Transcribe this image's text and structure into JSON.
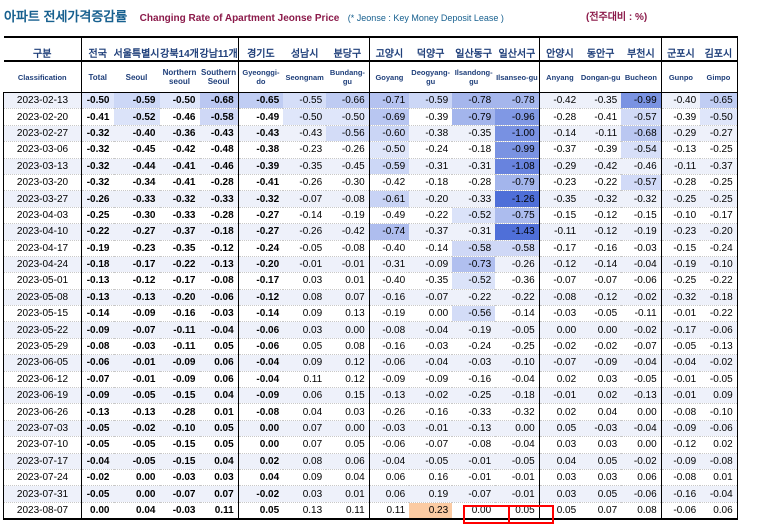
{
  "header": {
    "title_ko": "아파트 전세가격증감률",
    "title_en": "Changing Rate of Apartment Jeonse Price",
    "title_note": "(* Jeonse : Key Money Deposit Lease )",
    "unit": "(전주대비 : %)"
  },
  "table": {
    "columns_ko": [
      "구분",
      "전국",
      "서울특별시",
      "강북14개",
      "강남11개",
      "경기도",
      "성남시",
      "분당구",
      "고양시",
      "덕양구",
      "일산동구",
      "일산서구",
      "안양시",
      "동안구",
      "부천시",
      "군포시",
      "김포시"
    ],
    "columns_en": [
      "Classification",
      "Total",
      "Seoul",
      "Northern seoul",
      "Southern Seoul",
      "Gyeonggi-do",
      "Seongnam",
      "Bundang-gu",
      "Goyang",
      "Deogyang-gu",
      "Ilsandong-gu",
      "Ilsanseo-gu",
      "Anyang",
      "Dongan-gu",
      "Bucheon",
      "Gunpo",
      "Gimpo"
    ],
    "rows": [
      {
        "date": "2023-02-13",
        "values": [
          "-0.50",
          "-0.59",
          "-0.50",
          "-0.68",
          "-0.65",
          "-0.55",
          "-0.66",
          "-0.71",
          "-0.59",
          "-0.78",
          "-0.78",
          "-0.42",
          "-0.35",
          "-0.99",
          "-0.40",
          "-0.65"
        ]
      },
      {
        "date": "2023-02-20",
        "values": [
          "-0.41",
          "-0.52",
          "-0.46",
          "-0.58",
          "-0.49",
          "-0.50",
          "-0.50",
          "-0.69",
          "-0.39",
          "-0.79",
          "-0.96",
          "-0.28",
          "-0.41",
          "-0.57",
          "-0.39",
          "-0.50"
        ]
      },
      {
        "date": "2023-02-27",
        "values": [
          "-0.32",
          "-0.40",
          "-0.36",
          "-0.43",
          "-0.43",
          "-0.43",
          "-0.56",
          "-0.60",
          "-0.38",
          "-0.35",
          "-1.00",
          "-0.14",
          "-0.11",
          "-0.68",
          "-0.29",
          "-0.27"
        ]
      },
      {
        "date": "2023-03-06",
        "values": [
          "-0.32",
          "-0.45",
          "-0.42",
          "-0.48",
          "-0.38",
          "-0.23",
          "-0.26",
          "-0.50",
          "-0.24",
          "-0.18",
          "-0.99",
          "-0.37",
          "-0.39",
          "-0.54",
          "-0.13",
          "-0.25"
        ]
      },
      {
        "date": "2023-03-13",
        "values": [
          "-0.32",
          "-0.44",
          "-0.41",
          "-0.46",
          "-0.39",
          "-0.35",
          "-0.45",
          "-0.59",
          "-0.31",
          "-0.31",
          "-1.08",
          "-0.29",
          "-0.42",
          "-0.46",
          "-0.11",
          "-0.37"
        ]
      },
      {
        "date": "2023-03-20",
        "values": [
          "-0.32",
          "-0.34",
          "-0.41",
          "-0.28",
          "-0.41",
          "-0.26",
          "-0.30",
          "-0.42",
          "-0.18",
          "-0.28",
          "-0.79",
          "-0.23",
          "-0.22",
          "-0.57",
          "-0.28",
          "-0.25"
        ]
      },
      {
        "date": "2023-03-27",
        "values": [
          "-0.26",
          "-0.33",
          "-0.32",
          "-0.33",
          "-0.32",
          "-0.07",
          "-0.08",
          "-0.61",
          "-0.20",
          "-0.33",
          "-1.26",
          "-0.35",
          "-0.32",
          "-0.32",
          "-0.25",
          "-0.25"
        ]
      },
      {
        "date": "2023-04-03",
        "values": [
          "-0.25",
          "-0.30",
          "-0.33",
          "-0.28",
          "-0.27",
          "-0.14",
          "-0.19",
          "-0.49",
          "-0.22",
          "-0.52",
          "-0.75",
          "-0.15",
          "-0.12",
          "-0.15",
          "-0.10",
          "-0.17"
        ]
      },
      {
        "date": "2023-04-10",
        "values": [
          "-0.22",
          "-0.27",
          "-0.37",
          "-0.18",
          "-0.27",
          "-0.26",
          "-0.42",
          "-0.74",
          "-0.37",
          "-0.31",
          "-1.43",
          "-0.11",
          "-0.12",
          "-0.19",
          "-0.23",
          "-0.20"
        ]
      },
      {
        "date": "2023-04-17",
        "values": [
          "-0.19",
          "-0.23",
          "-0.35",
          "-0.12",
          "-0.24",
          "-0.05",
          "-0.08",
          "-0.40",
          "-0.14",
          "-0.58",
          "-0.58",
          "-0.17",
          "-0.16",
          "-0.03",
          "-0.15",
          "-0.24"
        ]
      },
      {
        "date": "2023-04-24",
        "values": [
          "-0.18",
          "-0.17",
          "-0.22",
          "-0.13",
          "-0.20",
          "-0.01",
          "-0.01",
          "-0.31",
          "-0.09",
          "-0.73",
          "-0.26",
          "-0.12",
          "-0.14",
          "-0.04",
          "-0.19",
          "-0.10"
        ]
      },
      {
        "date": "2023-05-01",
        "values": [
          "-0.13",
          "-0.12",
          "-0.17",
          "-0.08",
          "-0.17",
          "0.03",
          "0.01",
          "-0.40",
          "-0.35",
          "-0.52",
          "-0.36",
          "-0.07",
          "-0.07",
          "-0.06",
          "-0.25",
          "-0.22"
        ]
      },
      {
        "date": "2023-05-08",
        "values": [
          "-0.13",
          "-0.13",
          "-0.20",
          "-0.06",
          "-0.12",
          "0.08",
          "0.07",
          "-0.16",
          "-0.07",
          "-0.22",
          "-0.22",
          "-0.08",
          "-0.12",
          "-0.02",
          "-0.32",
          "-0.18"
        ]
      },
      {
        "date": "2023-05-15",
        "values": [
          "-0.14",
          "-0.09",
          "-0.16",
          "-0.03",
          "-0.14",
          "0.09",
          "0.13",
          "-0.19",
          "0.00",
          "-0.56",
          "-0.14",
          "-0.03",
          "-0.05",
          "-0.11",
          "-0.01",
          "-0.22"
        ]
      },
      {
        "date": "2023-05-22",
        "values": [
          "-0.09",
          "-0.07",
          "-0.11",
          "-0.04",
          "-0.06",
          "0.03",
          "0.00",
          "-0.08",
          "-0.04",
          "-0.19",
          "-0.05",
          "0.00",
          "0.00",
          "-0.02",
          "-0.17",
          "-0.06"
        ]
      },
      {
        "date": "2023-05-29",
        "values": [
          "-0.08",
          "-0.03",
          "-0.11",
          "0.05",
          "-0.06",
          "0.05",
          "0.08",
          "-0.16",
          "-0.03",
          "-0.24",
          "-0.25",
          "-0.02",
          "-0.02",
          "-0.07",
          "-0.05",
          "-0.13"
        ]
      },
      {
        "date": "2023-06-05",
        "values": [
          "-0.06",
          "-0.01",
          "-0.09",
          "0.06",
          "-0.04",
          "0.09",
          "0.12",
          "-0.06",
          "-0.04",
          "-0.03",
          "-0.10",
          "-0.07",
          "-0.09",
          "-0.04",
          "-0.04",
          "-0.02"
        ]
      },
      {
        "date": "2023-06-12",
        "values": [
          "-0.07",
          "-0.01",
          "-0.09",
          "0.06",
          "-0.04",
          "0.11",
          "0.12",
          "-0.09",
          "-0.09",
          "-0.16",
          "-0.04",
          "0.02",
          "0.03",
          "-0.05",
          "-0.01",
          "-0.05"
        ]
      },
      {
        "date": "2023-06-19",
        "values": [
          "-0.09",
          "-0.05",
          "-0.15",
          "0.04",
          "-0.09",
          "0.06",
          "0.15",
          "-0.13",
          "-0.02",
          "-0.25",
          "-0.18",
          "-0.01",
          "0.02",
          "-0.13",
          "-0.01",
          "0.09"
        ]
      },
      {
        "date": "2023-06-26",
        "values": [
          "-0.13",
          "-0.13",
          "-0.28",
          "0.01",
          "-0.08",
          "0.04",
          "0.03",
          "-0.26",
          "-0.16",
          "-0.33",
          "-0.32",
          "0.02",
          "0.04",
          "0.00",
          "-0.08",
          "-0.10"
        ]
      },
      {
        "date": "2023-07-03",
        "values": [
          "-0.05",
          "-0.02",
          "-0.10",
          "0.05",
          "0.00",
          "0.07",
          "0.00",
          "-0.03",
          "-0.01",
          "-0.13",
          "0.00",
          "0.05",
          "-0.03",
          "-0.04",
          "-0.09",
          "-0.06"
        ]
      },
      {
        "date": "2023-07-10",
        "values": [
          "-0.05",
          "-0.05",
          "-0.15",
          "0.05",
          "0.00",
          "0.07",
          "0.05",
          "-0.06",
          "-0.07",
          "-0.08",
          "-0.04",
          "0.03",
          "0.03",
          "0.00",
          "-0.12",
          "0.02"
        ]
      },
      {
        "date": "2023-07-17",
        "values": [
          "-0.04",
          "-0.05",
          "-0.15",
          "0.04",
          "0.02",
          "0.08",
          "0.06",
          "-0.04",
          "-0.05",
          "-0.01",
          "-0.05",
          "0.04",
          "0.05",
          "-0.02",
          "-0.09",
          "-0.08"
        ]
      },
      {
        "date": "2023-07-24",
        "values": [
          "-0.02",
          "0.00",
          "-0.03",
          "0.03",
          "0.04",
          "0.09",
          "0.04",
          "0.06",
          "0.16",
          "-0.01",
          "-0.01",
          "0.03",
          "0.03",
          "0.06",
          "-0.08",
          "0.01"
        ]
      },
      {
        "date": "2023-07-31",
        "values": [
          "-0.05",
          "0.00",
          "-0.07",
          "0.07",
          "-0.02",
          "0.03",
          "0.01",
          "0.06",
          "0.19",
          "-0.07",
          "-0.01",
          "0.03",
          "0.05",
          "-0.06",
          "-0.16",
          "-0.04"
        ]
      },
      {
        "date": "2023-08-07",
        "values": [
          "0.00",
          "0.04",
          "-0.03",
          "0.11",
          "0.05",
          "0.13",
          "0.11",
          "0.11",
          "0.23",
          "0.00",
          "0.05",
          "0.05",
          "0.07",
          "0.08",
          "-0.06",
          "0.06"
        ]
      }
    ]
  },
  "colors": {
    "neg_dark": "#4f6fd8",
    "neg_light": "#dfe6fa",
    "positive_highlight": "#fbcba3",
    "frame_highlight": "#ff0000"
  }
}
